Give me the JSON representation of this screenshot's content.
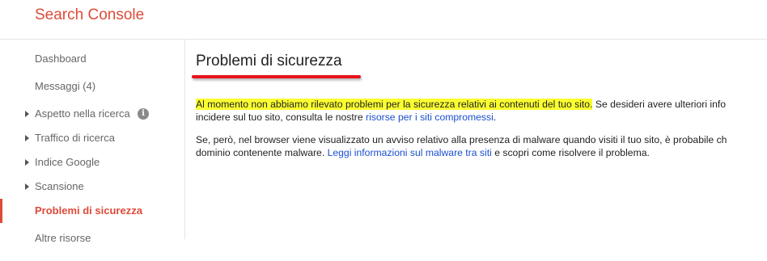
{
  "header": {
    "brand": "Search Console"
  },
  "sidebar": {
    "items": [
      {
        "label": "Dashboard",
        "expandable": false,
        "active": false
      },
      {
        "label": "Messaggi (4)",
        "expandable": false,
        "active": false
      },
      {
        "label": "Aspetto nella ricerca",
        "expandable": true,
        "active": false,
        "icon": "info-icon"
      },
      {
        "label": "Traffico di ricerca",
        "expandable": true,
        "active": false
      },
      {
        "label": "Indice Google",
        "expandable": true,
        "active": false
      },
      {
        "label": "Scansione",
        "expandable": true,
        "active": false
      },
      {
        "label": "Problemi di sicurezza",
        "expandable": false,
        "active": true
      },
      {
        "label": "Altre risorse",
        "expandable": false,
        "active": false
      }
    ],
    "info_glyph": "i"
  },
  "main": {
    "title": "Problemi di sicurezza",
    "para1": {
      "highlighted": "Al momento non abbiamo rilevato problemi per la sicurezza relativi ai contenuti del tuo sito.",
      "rest_line1": " Se desideri avere ulteriori info",
      "line2_text": "incidere sul tuo sito, consulta le nostre ",
      "link": "risorse per i siti compromessi",
      "line2_end": "."
    },
    "para2": {
      "line1": "Se, però, nel browser viene visualizzato un avviso relativo alla presenza di malware quando visiti il tuo sito, è probabile ch",
      "line2_text": "dominio contenente malware. ",
      "link": "Leggi informazioni sul malware tra siti",
      "line2_end": " e scopri come risolvere il problema."
    }
  },
  "colors": {
    "brand": "#dd4b39",
    "highlight": "#fbff2f",
    "link": "#1a4fcf",
    "title_underline": "#e8131b"
  }
}
